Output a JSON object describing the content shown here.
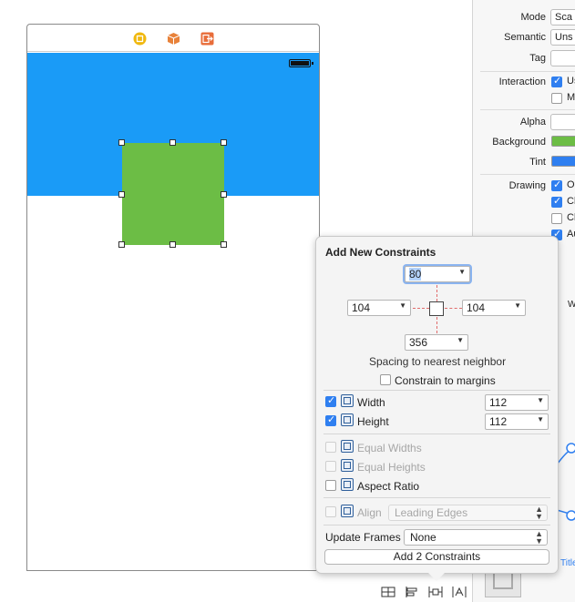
{
  "colors": {
    "blue_band": "#1a9bf7",
    "green_view": "#6cbd45",
    "dock_yellow": "#f0b80e",
    "dock_orange": "#e8823a",
    "dock_exit": "#e86d3a",
    "accent": "#2f7ff0"
  },
  "scene": {
    "dock_icons": [
      "view-controller-icon",
      "first-responder-icon",
      "exit-icon"
    ]
  },
  "inspector": {
    "mode_label": "Mode",
    "mode_value": "Sca",
    "semantic_label": "Semantic",
    "semantic_value": "Uns",
    "tag_label": "Tag",
    "tag_value": "",
    "interaction_label": "Interaction",
    "user_interaction_text": "Us",
    "multiple_touch_text": "M",
    "alpha_label": "Alpha",
    "alpha_value": "",
    "background_label": "Background",
    "tint_label": "Tint",
    "drawing_label": "Drawing",
    "opaque_text": "Op",
    "clears_text": "Cl",
    "clip_text": "Cl",
    "autoresize_text": "Au",
    "w_text": "W",
    "title_text": "Title"
  },
  "popover": {
    "title": "Add New Constraints",
    "top_value": "80",
    "left_value": "104",
    "right_value": "104",
    "bottom_value": "356",
    "spacing_label": "Spacing to nearest neighbor",
    "constrain_margins_label": "Constrain to margins",
    "width_label": "Width",
    "width_value": "112",
    "height_label": "Height",
    "height_value": "112",
    "equal_widths_label": "Equal Widths",
    "equal_heights_label": "Equal Heights",
    "aspect_ratio_label": "Aspect Ratio",
    "align_label": "Align",
    "align_value": "Leading Edges",
    "update_frames_label": "Update Frames",
    "update_frames_value": "None",
    "add_button_label": "Add 2 Constraints"
  },
  "toolbar": {
    "icons": [
      "stack-icon",
      "align-icon",
      "pin-icon",
      "resolve-issues-icon"
    ]
  }
}
